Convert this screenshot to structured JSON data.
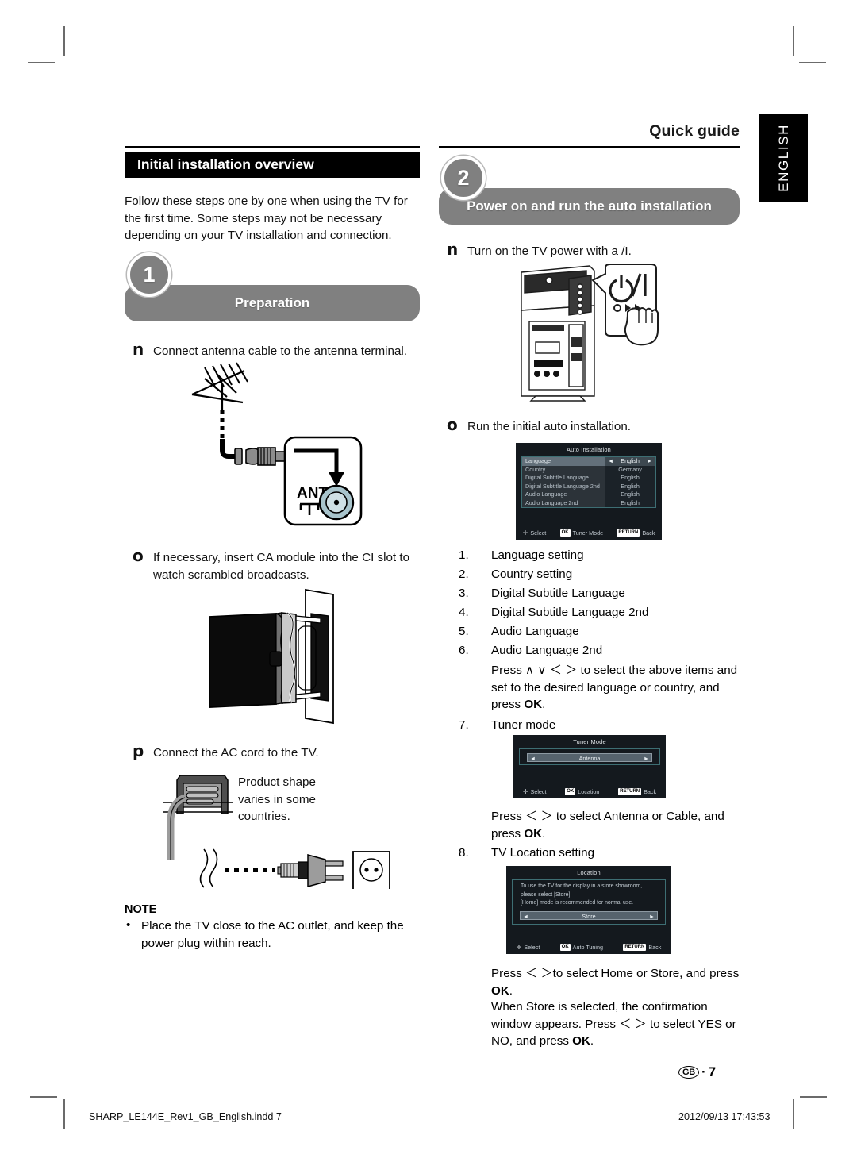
{
  "header": {
    "quick_guide": "Quick guide",
    "language_tab": "ENGLISH",
    "section_title": "Initial installation overview",
    "intro": "Follow these steps one by one when using the TV for the first time. Some steps may not be necessary depending on your TV installation and connection."
  },
  "step1": {
    "number": "1",
    "title": "Preparation",
    "items": [
      {
        "marker": "n",
        "text": "Connect antenna cable to the antenna terminal."
      },
      {
        "marker": "o",
        "text": "If necessary, insert CA module into the CI slot to watch scrambled broadcasts."
      },
      {
        "marker": "p",
        "text": "Connect the AC cord to the TV."
      }
    ],
    "antenna_label": "ANT",
    "ac_callout": "Product shape varies in some countries."
  },
  "note": {
    "title": "NOTE",
    "bullet": "•",
    "text": "Place the TV close to the AC outlet, and keep the power plug within reach."
  },
  "step2": {
    "number": "2",
    "title": "Power on and run the auto installation",
    "items": [
      {
        "marker": "n",
        "text": "Turn on the TV power with a /I."
      },
      {
        "marker": "o",
        "text": "Run the initial auto installation."
      }
    ],
    "list": [
      {
        "n": "1.",
        "t": "Language setting"
      },
      {
        "n": "2.",
        "t": "Country setting"
      },
      {
        "n": "3.",
        "t": "Digital Subtitle Language"
      },
      {
        "n": "4.",
        "t": "Digital Subtitle Language 2nd"
      },
      {
        "n": "5.",
        "t": "Audio Language"
      },
      {
        "n": "6.",
        "t": "Audio Language 2nd"
      }
    ],
    "press_items": "Press ∧ ∨ ＜ ＞ to select the above items and set to the desired language or country, and press ",
    "press_items_ok": "OK",
    "press_items_end": ".",
    "item7_n": "7.",
    "item7_t": "Tuner mode",
    "press_tuner": "Press ＜ ＞ to select Antenna or Cable, and press ",
    "press_tuner_ok": "OK",
    "press_tuner_end": ".",
    "item8_n": "8.",
    "item8_t": "TV Location setting",
    "press_location": "Press ＜ ＞to select Home or Store, and press ",
    "press_location_ok": "OK",
    "press_location_end": ".",
    "store_note_a": "When Store is selected, the confirmation window appears. Press ＜ ＞ to select YES or NO, and press ",
    "store_note_ok": "OK",
    "store_note_end": "."
  },
  "osd_auto_install": {
    "title": "Auto Installation",
    "rows": [
      {
        "key": "Language",
        "value": "English",
        "selected": true
      },
      {
        "key": "Country",
        "value": "Germany",
        "selected": false
      },
      {
        "key": "Digital Subtitle Language",
        "value": "English",
        "selected": false
      },
      {
        "key": "Digital Subtitle Language 2nd",
        "value": "English",
        "selected": false
      },
      {
        "key": "Audio Language",
        "value": "English",
        "selected": false
      },
      {
        "key": "Audio Language 2nd",
        "value": "English",
        "selected": false
      }
    ],
    "foot": [
      {
        "cap": "",
        "icon": "dpad-icon",
        "label": "Select"
      },
      {
        "cap": "OK",
        "icon": "",
        "label": "Tuner Mode"
      },
      {
        "cap": "RETURN",
        "icon": "",
        "label": "Back"
      }
    ]
  },
  "osd_tuner_mode": {
    "title": "Tuner Mode",
    "value": "Antenna",
    "left_arrow": "◄",
    "right_arrow": "►",
    "foot": [
      {
        "cap": "",
        "icon": "dpad-icon",
        "label": "Select"
      },
      {
        "cap": "OK",
        "icon": "",
        "label": "Location"
      },
      {
        "cap": "RETURN",
        "icon": "",
        "label": "Back"
      }
    ]
  },
  "osd_location": {
    "title": "Location",
    "desc_line1": "To use the TV for the display in a store showroom,",
    "desc_line2": "please select [Store].",
    "desc_line3": "[Home] mode is recommended for normal use.",
    "value": "Store",
    "left_arrow": "◄",
    "right_arrow": "►",
    "foot": [
      {
        "cap": "",
        "icon": "dpad-icon",
        "label": "Select"
      },
      {
        "cap": "OK",
        "icon": "",
        "label": "Auto Tuning"
      },
      {
        "cap": "RETURN",
        "icon": "",
        "label": "Back"
      }
    ]
  },
  "footer": {
    "region": "GB",
    "sep": "·",
    "page": "7",
    "file": "SHARP_LE144E_Rev1_GB_English.indd   7",
    "date": "2012/09/13   17:43:53"
  },
  "colors": {
    "gray_bar": "#808080",
    "black": "#000000",
    "osd_bg": "#14191e",
    "osd_highlight": "#63707a",
    "ant_terminal": "#a8c4cc"
  }
}
